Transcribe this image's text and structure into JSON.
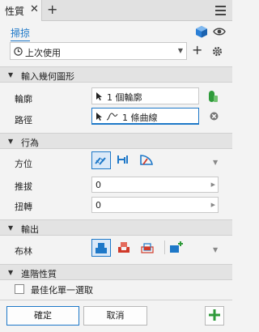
{
  "tab": {
    "label": "性質"
  },
  "sweep": {
    "label": "掃掠"
  },
  "preset": {
    "value": "上次使用"
  },
  "sections": {
    "geometry": "輸入幾何圖形",
    "behavior": "行為",
    "output": "輸出",
    "advanced": "進階性質"
  },
  "geometry": {
    "profile_label": "輪廓",
    "profile_value": "1 個輪廓",
    "path_label": "路徑",
    "path_value": "1 條曲線"
  },
  "behavior": {
    "orientation_label": "方位",
    "taper_label": "推拔",
    "taper_value": "0",
    "twist_label": "扭轉",
    "twist_value": "0"
  },
  "output": {
    "boolean_label": "布林"
  },
  "advanced": {
    "optimize_label": "最佳化單一選取"
  },
  "buttons": {
    "ok": "確定",
    "cancel": "取消"
  },
  "colors": {
    "accent": "#1e78c8",
    "green": "#2e9a3a"
  }
}
